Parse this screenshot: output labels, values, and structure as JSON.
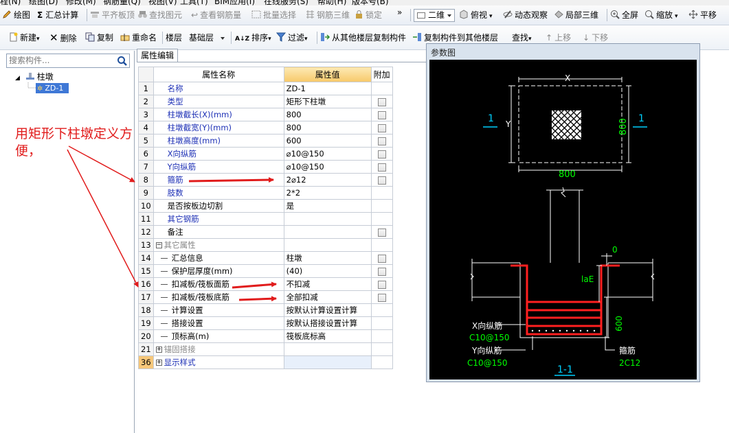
{
  "menubar": {
    "items": [
      "程(N)",
      "绘图(D)",
      "修改(M)",
      "钢筋量(Q)",
      "视图(V)",
      "工具(T)",
      "BIM应用(I)",
      "在线服务(S)",
      "帮助(H)",
      "版本号(B)"
    ]
  },
  "toolbar1": {
    "draw": "绘图",
    "sum": "汇总计算",
    "flat_top": "平齐板顶",
    "find_element": "查找图元",
    "view_rebar": "查看钢筋量",
    "batch_select": "批量选择",
    "rebar_3d": "钢筋三维",
    "lock": "锁定",
    "more": "»",
    "view_2d": "二维",
    "top_view": "俯视",
    "dynamic_view": "动态观察",
    "local_3d": "局部三维",
    "fullscreen": "全屏",
    "zoom": "缩放",
    "pan": "平移"
  },
  "toolbar2": {
    "new": "新建",
    "delete": "删除",
    "copy": "复制",
    "rename": "重命名",
    "floor_label": "楼层",
    "floor_value": "基础层",
    "sort": "排序",
    "filter": "过滤",
    "copy_from_floor": "从其他楼层复制构件",
    "copy_to_floor": "复制构件到其他楼层",
    "find": "查找",
    "move_up": "上移",
    "move_down": "下移"
  },
  "left_panel": {
    "search_placeholder": "搜索构件...",
    "tree_root": "柱墩",
    "tree_child": "ZD-1"
  },
  "props": {
    "tab": "属性编辑",
    "headers": {
      "num": "",
      "name": "属性名称",
      "value": "属性值",
      "add": "附加"
    },
    "rows": [
      {
        "num": "1",
        "name": "名称",
        "value": "ZD-1"
      },
      {
        "num": "2",
        "name": "类型",
        "value": "矩形下柱墩"
      },
      {
        "num": "3",
        "name": "柱墩截长(X)(mm)",
        "value": "800"
      },
      {
        "num": "4",
        "name": "柱墩截宽(Y)(mm)",
        "value": "800"
      },
      {
        "num": "5",
        "name": "柱墩高度(mm)",
        "value": "600"
      },
      {
        "num": "6",
        "name": "X向纵筋",
        "value": "⌀10@150"
      },
      {
        "num": "7",
        "name": "Y向纵筋",
        "value": "⌀10@150"
      },
      {
        "num": "8",
        "name": "箍筋",
        "value": "2⌀12"
      },
      {
        "num": "9",
        "name": "肢数",
        "value": "2*2"
      },
      {
        "num": "10",
        "name": "是否按板边切割",
        "value": "是"
      },
      {
        "num": "11",
        "name": "其它钢筋",
        "value": ""
      },
      {
        "num": "12",
        "name": "备注",
        "value": ""
      },
      {
        "num": "13",
        "name": "其它属性",
        "value": ""
      },
      {
        "num": "14",
        "name": "汇总信息",
        "value": "柱墩"
      },
      {
        "num": "15",
        "name": "保护层厚度(mm)",
        "value": "(40)"
      },
      {
        "num": "16",
        "name": "扣减板/筏板面筋",
        "value": "不扣减"
      },
      {
        "num": "17",
        "name": "扣减板/筏板底筋",
        "value": "全部扣减"
      },
      {
        "num": "18",
        "name": "计算设置",
        "value": "按默认计算设置计算"
      },
      {
        "num": "19",
        "name": "搭接设置",
        "value": "按默认搭接设置计算"
      },
      {
        "num": "20",
        "name": "顶标高(m)",
        "value": "筏板底标高"
      },
      {
        "num": "21",
        "name": "锚固搭接",
        "value": ""
      },
      {
        "num": "36",
        "name": "显示样式",
        "value": ""
      }
    ]
  },
  "annotation": {
    "text": "用矩形下柱墩定义方便，",
    "color": "#e11c1c"
  },
  "param_window": {
    "title": "参数图",
    "plan": {
      "x_label": "X",
      "y_label": "Y",
      "dim_x": "800",
      "dim_y": "800",
      "section_mark_left": "1",
      "section_mark_right": "1"
    },
    "section": {
      "zero": "0",
      "lae": "laE",
      "height": "600",
      "x_rebar_label": "X向纵筋",
      "x_rebar_value": "C10@150",
      "y_rebar_label": "Y向纵筋",
      "y_rebar_value": "C10@150",
      "stirrup_label": "箍筋",
      "stirrup_value": "2C12",
      "section_title": "1-1"
    },
    "colors": {
      "background": "#000000",
      "lines": "#ffffff",
      "rebar": "#ff2020",
      "dims": "#00ff00",
      "marks": "#00d0ff"
    }
  }
}
